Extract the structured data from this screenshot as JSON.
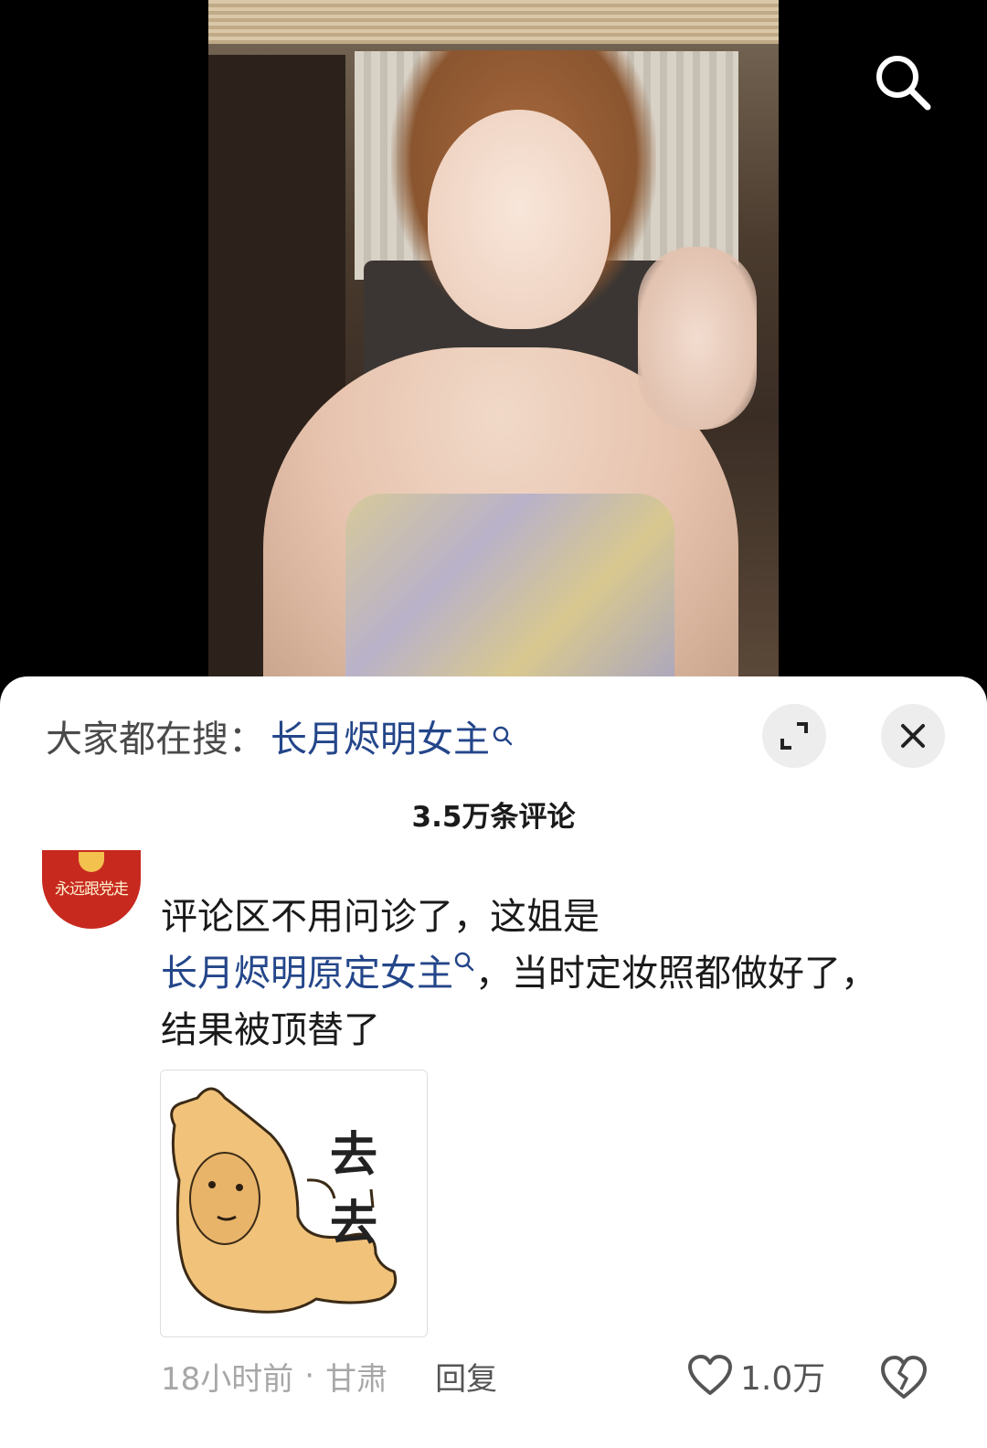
{
  "video": {
    "search_icon": "search-icon"
  },
  "sheet": {
    "search_prefix": "大家都在搜：",
    "search_term": "长月烬明女主",
    "expand_icon": "expand-icon",
    "close_icon": "close-icon",
    "comments_count": "3.5万条评论"
  },
  "comment": {
    "avatar_text": "永远跟党走",
    "text_part1": "评论区不用问诊了，这姐是",
    "text_link": "长月烬明原定女主",
    "text_part2": "，当时定妆照都做好了，结果被顶替了",
    "sticker_text": "去去",
    "time": "18小时前",
    "dot": "·",
    "location": "甘肃",
    "reply_label": "回复",
    "like_count": "1.0万",
    "like_icon": "heart-icon",
    "dislike_icon": "broken-heart-icon"
  },
  "colors": {
    "link": "#24468a",
    "muted": "#a7a7a7",
    "background": "#ffffff"
  }
}
